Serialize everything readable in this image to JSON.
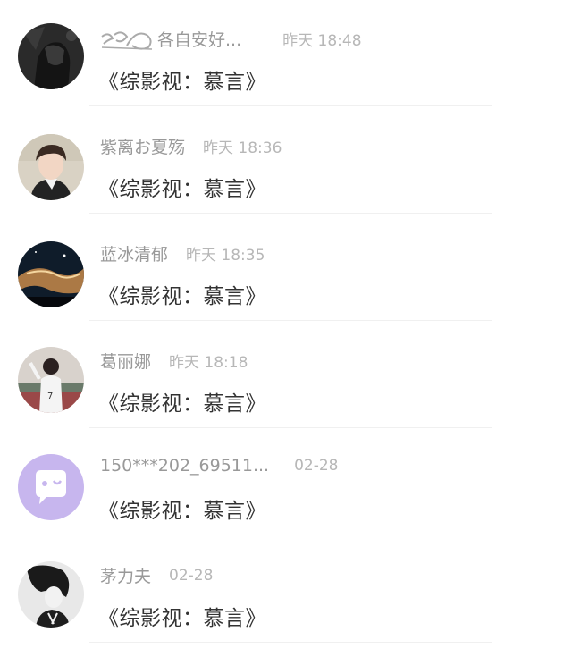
{
  "comments": [
    {
      "user_name": "各自安好...",
      "time": "昨天 18:48",
      "message": "《综影视：慕言》",
      "avatar_icon": "user-avatar-dark-icon"
    },
    {
      "user_name": "紫离お夏殇",
      "time": "昨天 18:36",
      "message": "《综影视：慕言》",
      "avatar_icon": "user-avatar-portrait-icon"
    },
    {
      "user_name": "蓝冰清郁",
      "time": "昨天 18:35",
      "message": "《综影视：慕言》",
      "avatar_icon": "user-avatar-nebula-icon"
    },
    {
      "user_name": "葛丽娜",
      "time": "昨天 18:18",
      "message": "《综影视：慕言》",
      "avatar_icon": "user-avatar-girl-icon"
    },
    {
      "user_name": "150***202_69511...",
      "time": "02-28",
      "message": "《综影视：慕言》",
      "avatar_icon": "default-avatar-chat-bubble-icon"
    },
    {
      "user_name": "茅力夫",
      "time": "02-28",
      "message": "《综影视：慕言》",
      "avatar_icon": "user-avatar-sketch-icon"
    }
  ],
  "colors": {
    "name": "#999999",
    "time": "#b7b7b7",
    "message": "#333333",
    "default_avatar_bg": "#c7b6ee"
  }
}
